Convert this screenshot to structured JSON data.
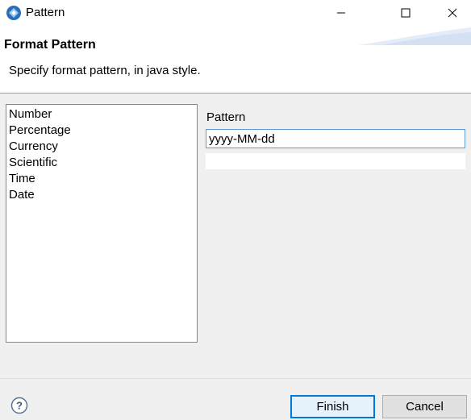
{
  "window": {
    "title": "Pattern",
    "app_icon": "eclipse-app-icon",
    "controls": [
      "minimize-icon",
      "maximize-icon",
      "close-icon"
    ]
  },
  "header": {
    "title": "Format Pattern",
    "description": "Specify format pattern, in java style."
  },
  "types": {
    "items": [
      "Number",
      "Percentage",
      "Currency",
      "Scientific",
      "Time",
      "Date"
    ]
  },
  "pattern": {
    "label": "Pattern",
    "value": "yyyy-MM-dd",
    "preview": ""
  },
  "footer": {
    "help_icon": "help-icon",
    "finish_label": "Finish",
    "cancel_label": "Cancel"
  },
  "colors": {
    "focus_accent": "#0078d7",
    "input_border": "#5b9bd5",
    "dialog_bg": "#f0f0f0"
  }
}
